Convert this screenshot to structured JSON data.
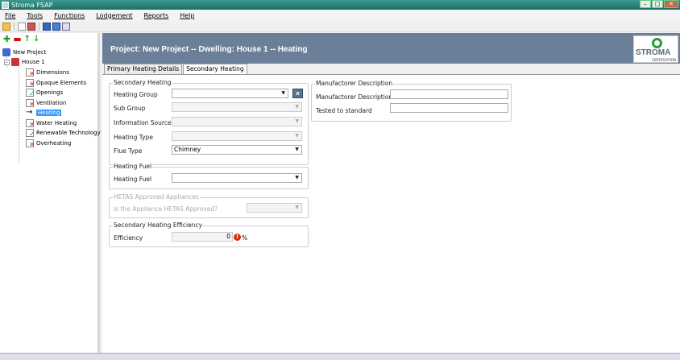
{
  "window": {
    "title": "Stroma FSAP"
  },
  "menu": [
    "File",
    "Tools",
    "Functions",
    "Lodgement",
    "Reports",
    "Help"
  ],
  "tree": {
    "root": "New Project",
    "house": "House 1",
    "items": [
      {
        "label": "Dimensions",
        "status": "bad"
      },
      {
        "label": "Opaque Elements",
        "status": "bad"
      },
      {
        "label": "Openings",
        "status": "ok"
      },
      {
        "label": "Ventilation",
        "status": "bad"
      },
      {
        "label": "Heating",
        "status": "current"
      },
      {
        "label": "Water Heating",
        "status": "bad"
      },
      {
        "label": "Renewable Technology",
        "status": "ok"
      },
      {
        "label": "Overheating",
        "status": "bad"
      }
    ]
  },
  "header": {
    "title": "Project: New Project -- Dwelling: House 1 -- Heating",
    "logo_name": "STROMA",
    "logo_sub": "CERTIFICATION"
  },
  "tabs": [
    "Primary Heating Details",
    "Secondary Heating"
  ],
  "secondary": {
    "title": "Secondary Heating",
    "heating_group_label": "Heating Group",
    "heating_group_value": "",
    "clear_label": "x",
    "sub_group_label": "Sub Group",
    "info_source_label": "Information Source",
    "heating_type_label": "Heating Type",
    "flue_type_label": "Flue Type",
    "flue_type_value": "Chimney"
  },
  "fuel": {
    "title": "Heating Fuel",
    "label": "Heating Fuel",
    "value": ""
  },
  "hetas": {
    "title": "HETAS Approved Appliances",
    "label": "Is the Appliance HETAS Approved?"
  },
  "efficiency": {
    "title": "Secondary Heating Efficiency",
    "label": "Efficiency",
    "value": "0",
    "unit": "%"
  },
  "manufacturer": {
    "title": "Manufactorer Description",
    "desc_label": "Manufactorer Description",
    "desc_value": "",
    "tested_label": "Tested to standard",
    "tested_value": ""
  },
  "icons": {
    "arrow": "→",
    "dropdown": "▼",
    "plus": "✚",
    "minus": "▬",
    "up": "↑",
    "down": "↓",
    "minimize": "–",
    "maximize": "□",
    "close": "✕",
    "warning": "!",
    "bad": "✕",
    "ok": "✓",
    "expander": "–"
  }
}
